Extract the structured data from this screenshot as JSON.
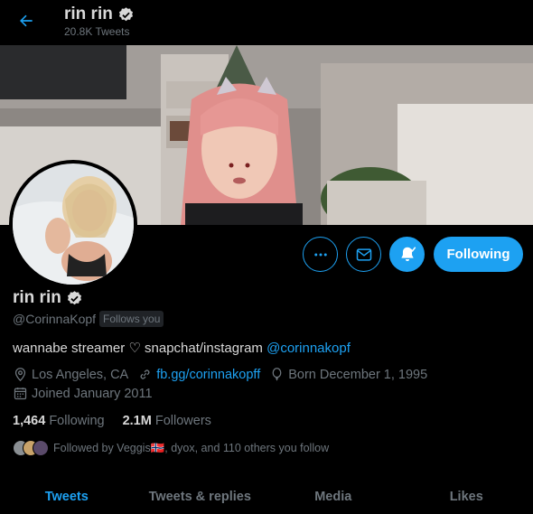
{
  "header": {
    "name": "rin rin",
    "tweet_count": "20.8K Tweets"
  },
  "profile": {
    "name": "rin rin",
    "handle": "@CorinnaKopf",
    "follows_you": "Follows you",
    "bio_text": "wannabe streamer ♡ snapchat/instagram ",
    "bio_mention": "@corinnakopf",
    "location": "Los Angeles, CA",
    "website": "fb.gg/corinnakopff",
    "birthday": "Born December 1, 1995",
    "joined": "Joined January 2011",
    "following_count": "1,464",
    "following_label": "Following",
    "followers_count": "2.1M",
    "followers_label": "Followers",
    "followed_by_text": "Followed by Veggis🇳🇴, dyox, and 110 others you follow"
  },
  "actions": {
    "following_label": "Following"
  },
  "tabs": [
    {
      "label": "Tweets",
      "active": true
    },
    {
      "label": "Tweets & replies",
      "active": false
    },
    {
      "label": "Media",
      "active": false
    },
    {
      "label": "Likes",
      "active": false
    }
  ],
  "colors": {
    "accent": "#1da1f2",
    "background": "#000000",
    "muted": "#6e767d",
    "text": "#d9d9d9"
  },
  "icons": [
    "back-arrow-icon",
    "verified-badge-icon",
    "more-icon",
    "mail-icon",
    "bell-notification-icon",
    "location-icon",
    "link-icon",
    "balloon-icon",
    "calendar-icon"
  ]
}
